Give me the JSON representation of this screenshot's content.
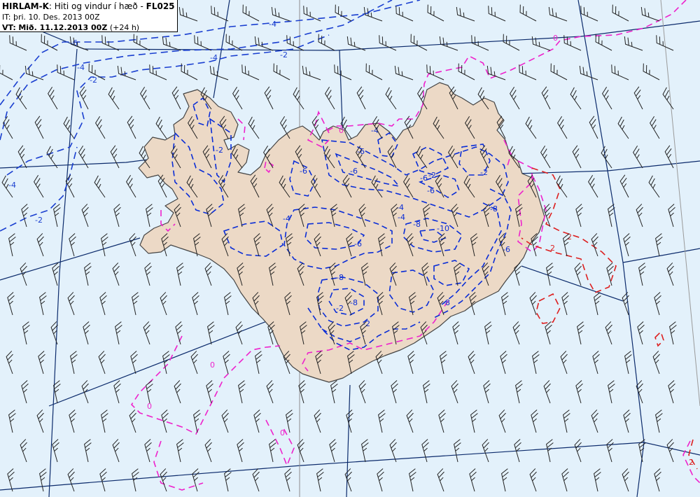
{
  "header": {
    "model": "HIRLAM-K",
    "separator": ":",
    "description": "Hiti og vindur í hæð -",
    "level": "FL025",
    "it_line": "IT: þri. 10. Des. 2013 00Z",
    "vt_prefix": "VT:",
    "vt_date": "Mið. 11.12.2013 00Z",
    "vt_offset": "(+24 h)"
  },
  "colors": {
    "sea": "#e3f1fb",
    "land": "#ecd9c6",
    "coast": "#444444",
    "grid": "#0b2a6b",
    "meridian": "#8c8c8c",
    "cold_isotherm": "#0a2dd6",
    "cold_isotherm_sea": "#1a3fd0",
    "zero_isotherm": "#ee22cc",
    "warm_isotherm": "#dd1f1f",
    "wind_barb": "#222222"
  },
  "contour_labels": {
    "sea": [
      "-6",
      "-4",
      "-4",
      "-2",
      "-2",
      "-4",
      "-2",
      "-4"
    ],
    "zero": [
      "0",
      "0",
      "0",
      "0",
      "0"
    ],
    "warm": [
      "2",
      "2",
      "2"
    ],
    "land": [
      "-2",
      "-4",
      "-6",
      "-6",
      "-6",
      "-4",
      "-4",
      "-6",
      "-8",
      "-2",
      "-8",
      "-2",
      "-4",
      "-6",
      "-8",
      "-6",
      "-8",
      "-2",
      "-10",
      "-8",
      "-6",
      "-2"
    ]
  },
  "icons": [
    "wind-barb-icon"
  ]
}
